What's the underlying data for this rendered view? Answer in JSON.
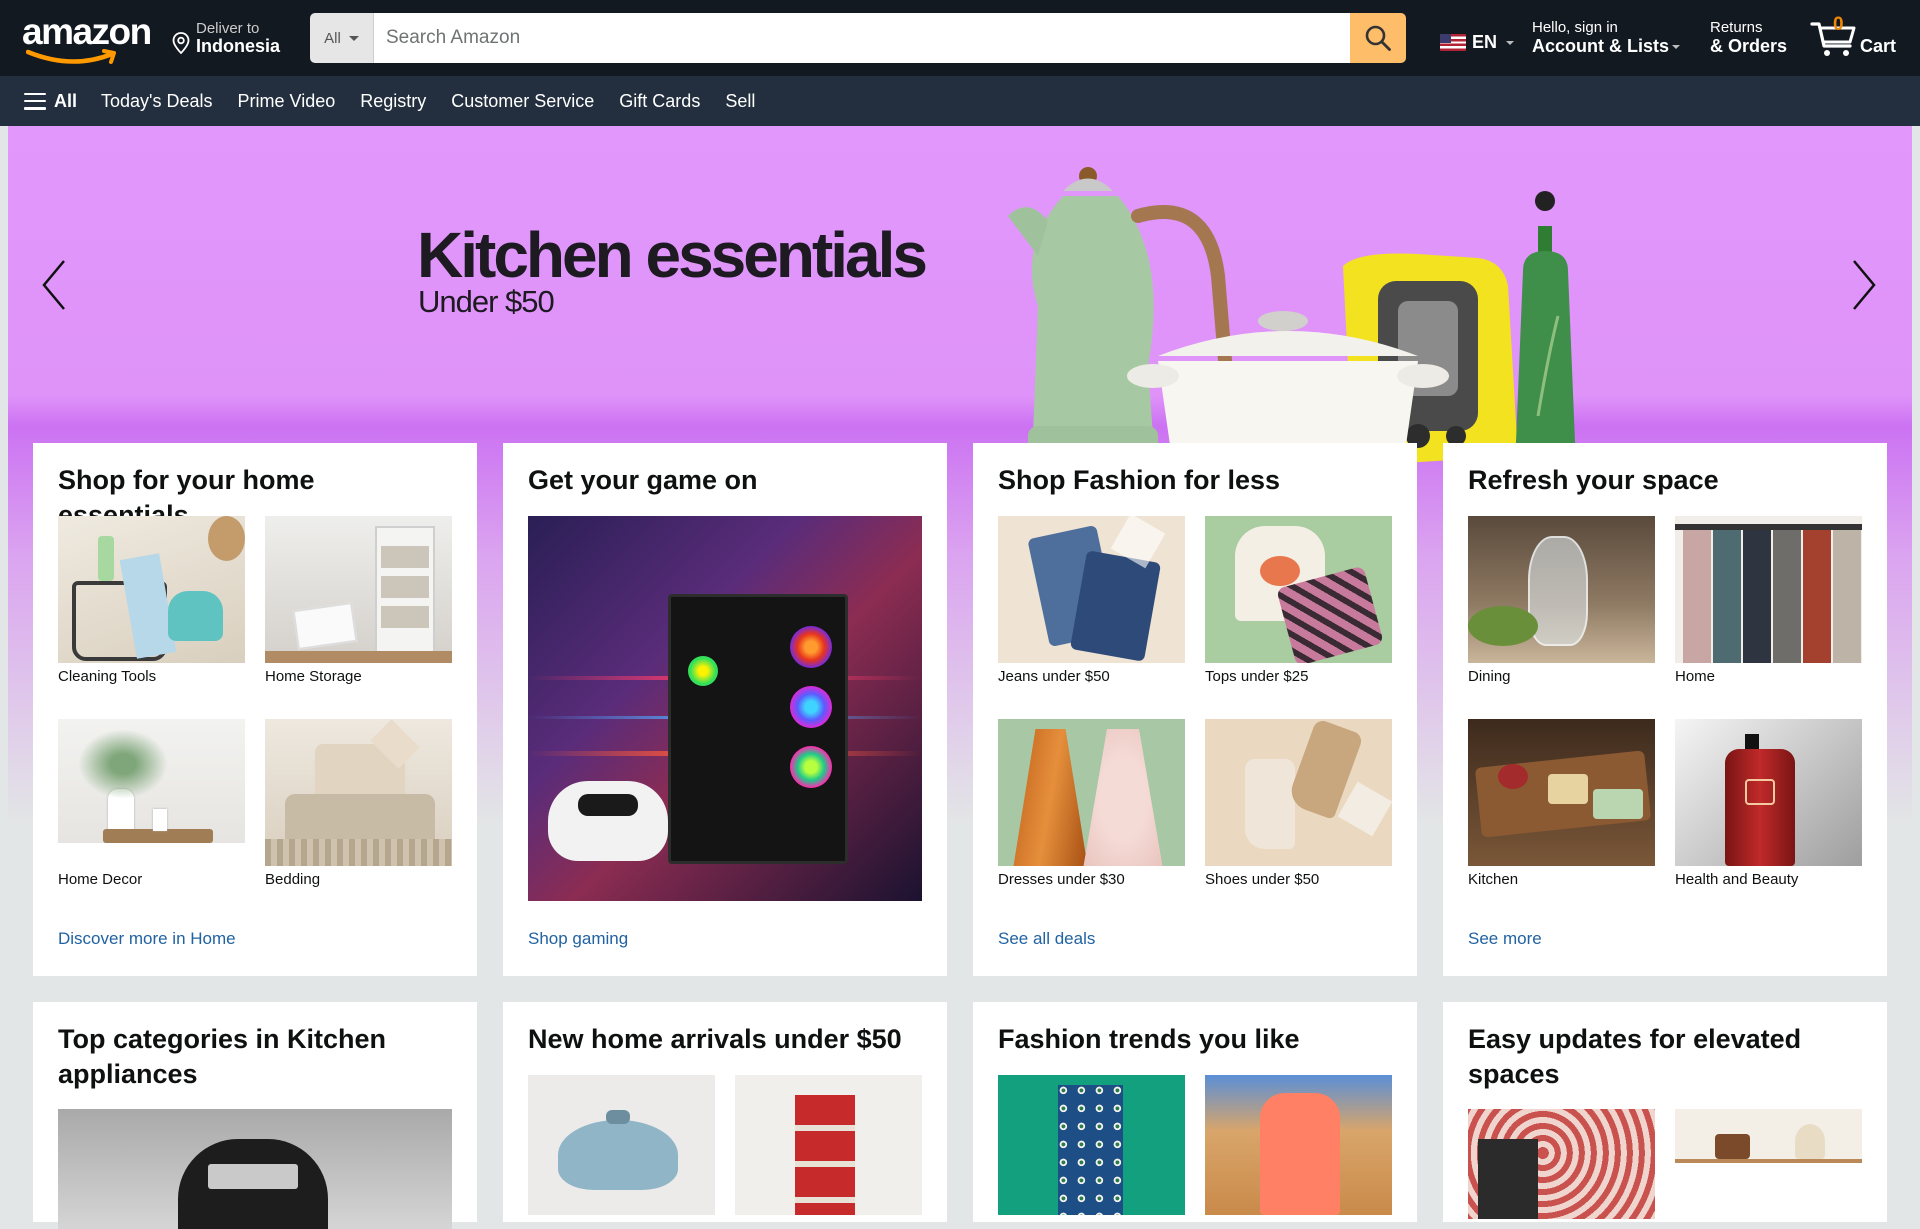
{
  "header": {
    "logo": "amazon",
    "deliver_label": "Deliver to",
    "deliver_location": "Indonesia",
    "search_category": "All",
    "search_placeholder": "Search Amazon",
    "language": "EN",
    "account_greeting": "Hello, sign in",
    "account_label": "Account & Lists",
    "returns_label": "Returns",
    "orders_label": "& Orders",
    "cart_count": "0",
    "cart_label": "Cart"
  },
  "subnav": {
    "all_label": "All",
    "items": [
      "Today's Deals",
      "Prime Video",
      "Registry",
      "Customer Service",
      "Gift Cards",
      "Sell"
    ]
  },
  "hero": {
    "title": "Kitchen essentials",
    "subtitle": "Under $50",
    "background": "#e197fb"
  },
  "cards": [
    {
      "title": "Shop for your home essentials",
      "items": [
        "Cleaning Tools",
        "Home Storage",
        "Home Decor",
        "Bedding"
      ],
      "link": "Discover more in Home"
    },
    {
      "title": "Get your game on",
      "link": "Shop gaming"
    },
    {
      "title": "Shop Fashion for less",
      "items": [
        "Jeans under $50",
        "Tops under $25",
        "Dresses under $30",
        "Shoes under $50"
      ],
      "link": "See all deals"
    },
    {
      "title": "Refresh your space",
      "items": [
        "Dining",
        "Home",
        "Kitchen",
        "Health and Beauty"
      ],
      "link": "See more"
    },
    {
      "title": "Top categories in Kitchen appliances"
    },
    {
      "title": "New home arrivals under $50"
    },
    {
      "title": "Fashion trends you like"
    },
    {
      "title": "Easy updates for elevated spaces"
    }
  ],
  "colors": {
    "nav_bg": "#131921",
    "subnav_bg": "#232f3e",
    "search_button": "#febd69",
    "cart_count": "#f08804",
    "link": "#2162a1"
  }
}
